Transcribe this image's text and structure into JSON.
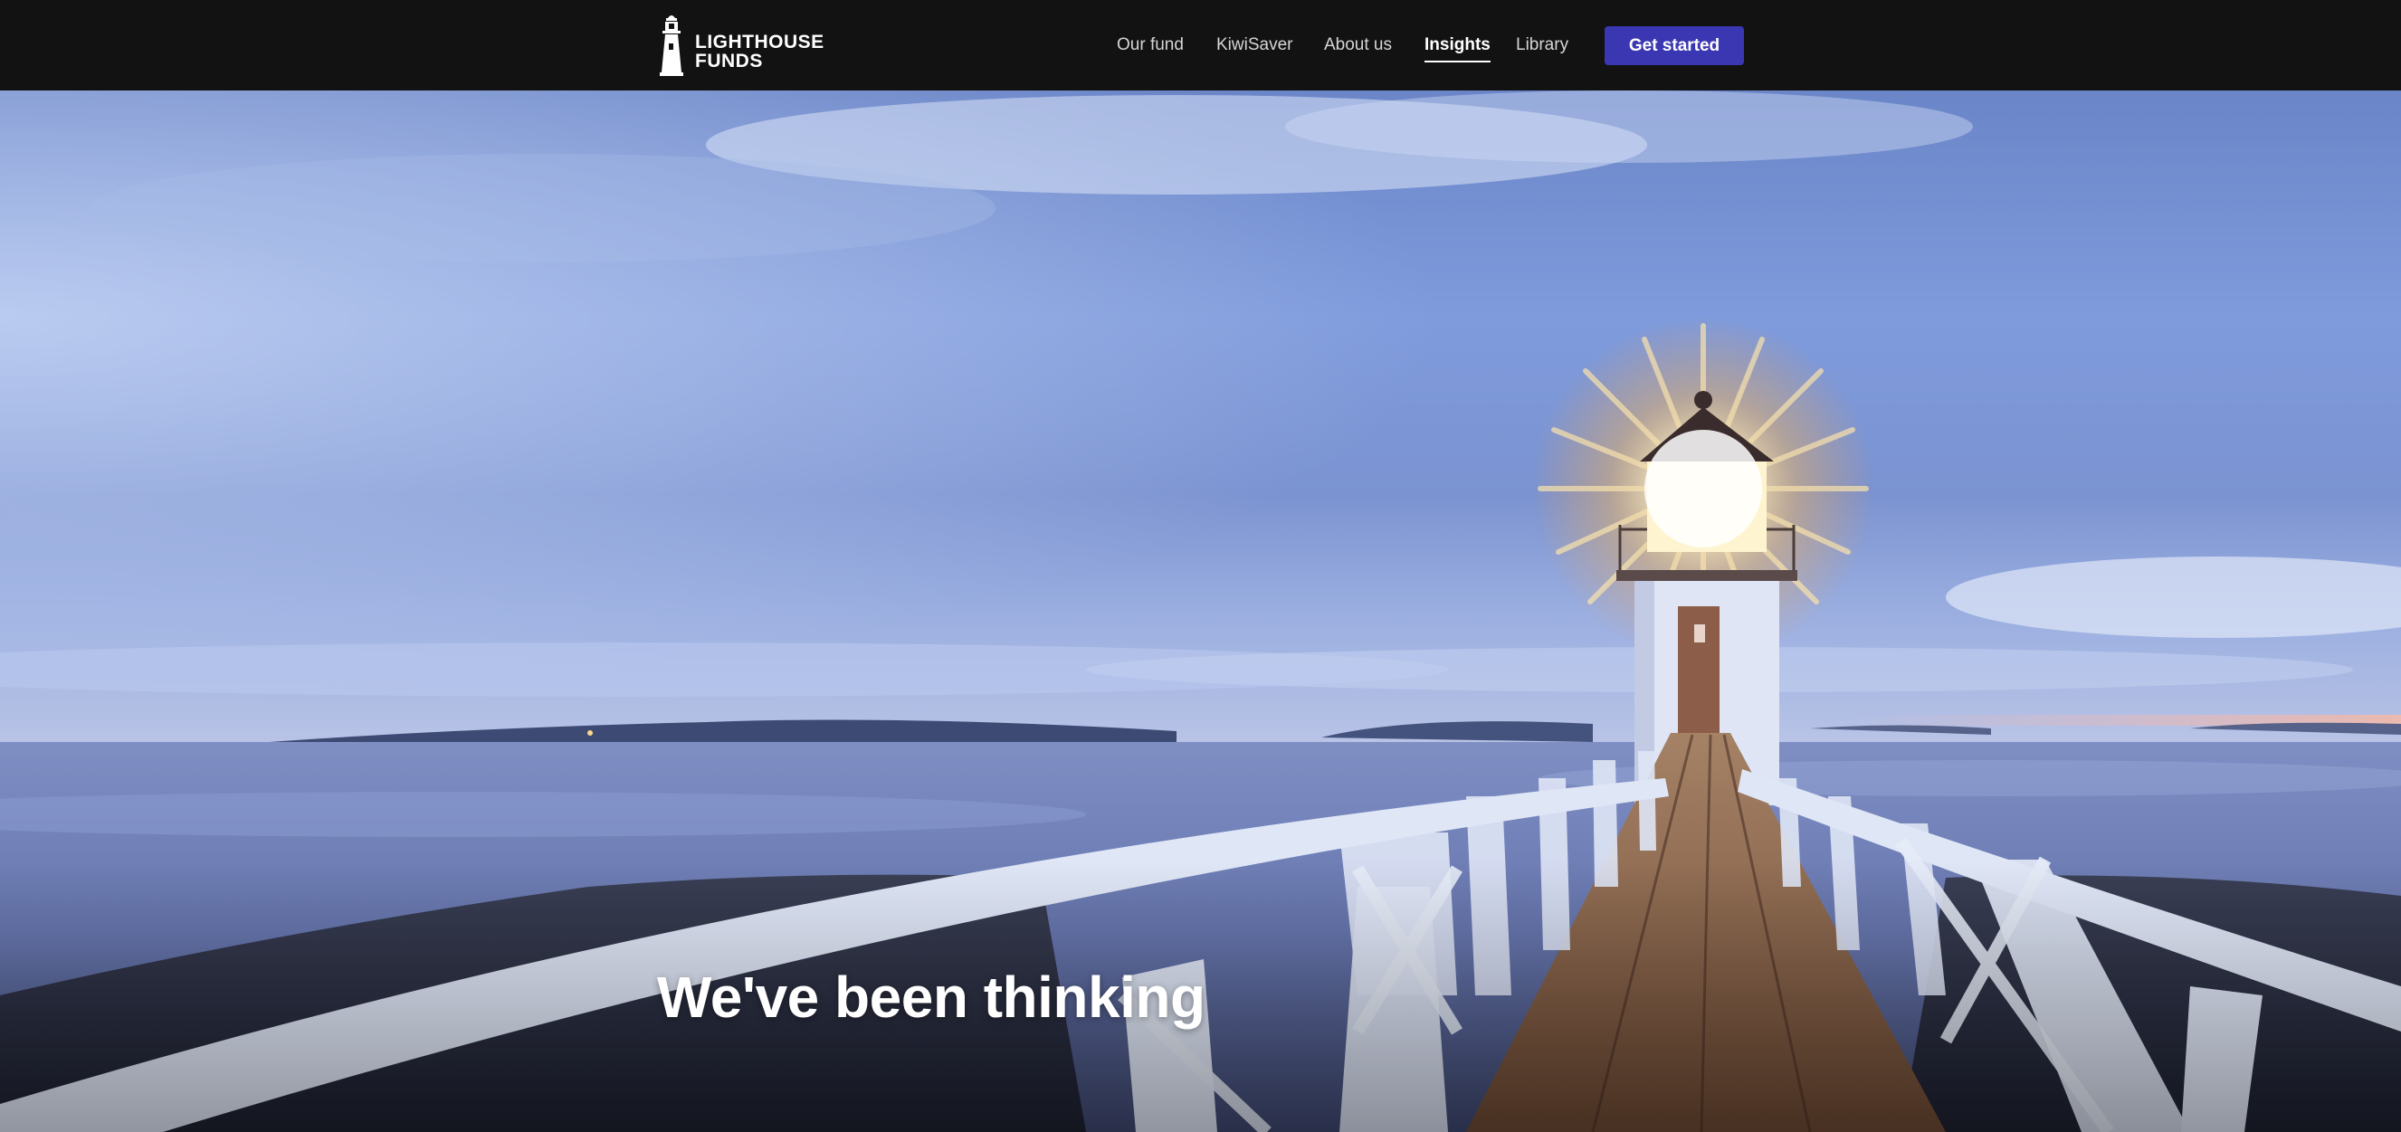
{
  "brand": {
    "logo_line1": "LIGHTHOUSE",
    "logo_line2": "FUNDS",
    "logo_icon": "lighthouse-icon"
  },
  "nav": {
    "items": [
      {
        "label": "Our fund",
        "active": false
      },
      {
        "label": "KiwiSaver",
        "active": false
      },
      {
        "label": "About us",
        "active": false
      },
      {
        "label": "Insights",
        "active": true
      },
      {
        "label": "Library",
        "active": false
      }
    ],
    "cta_label": "Get started"
  },
  "hero": {
    "title": "We've been thinking",
    "image_subject": "lighthouse at dusk with wooden walkway"
  },
  "colors": {
    "navbar_bg": "#121212",
    "cta_bg": "#3b37b3",
    "nav_text": "#d6d6d6",
    "active_text": "#ffffff"
  }
}
